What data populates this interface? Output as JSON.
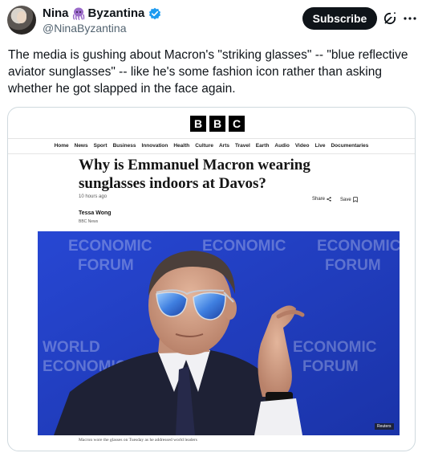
{
  "tweet": {
    "display_name": "Nina",
    "display_name_suffix": "Byzantina",
    "handle": "@NinaByzantina",
    "verified": true,
    "subscribe_label": "Subscribe",
    "text": "The media is gushing about Macron's \"striking glasses\" -- \"blue reflective aviator sunglasses\" -- like he's some fashion icon rather than asking whether he got slapped in the face again."
  },
  "article": {
    "logo_letters": [
      "B",
      "B",
      "C"
    ],
    "nav_items": [
      "Home",
      "News",
      "Sport",
      "Business",
      "Innovation",
      "Health",
      "Culture",
      "Arts",
      "Travel",
      "Earth",
      "Audio",
      "Video",
      "Live",
      "Documentaries"
    ],
    "headline": "Why is Emmanuel Macron wearing sunglasses indoors at Davos?",
    "time_ago": "10 hours ago",
    "share_label": "Share",
    "save_label": "Save",
    "author": "Tessa Wong",
    "outlet": "BBC News",
    "photo_credit": "Reuters",
    "caption": "Macron wore the glasses on Tuesday as he addressed world leaders",
    "backdrop_text": [
      "ECONOMIC",
      "FORUM",
      "WORLD",
      "ECONOMIC"
    ]
  },
  "colors": {
    "button_bg": "#0f1419",
    "verified_blue": "#1d9bf0",
    "backdrop_blue": "#1f3fc4",
    "octopus_purple": "#9b6bc9"
  },
  "icons": [
    "octopus-emoji-icon",
    "verified-badge-icon",
    "grok-icon",
    "more-icon",
    "share-icon",
    "bookmark-icon"
  ]
}
